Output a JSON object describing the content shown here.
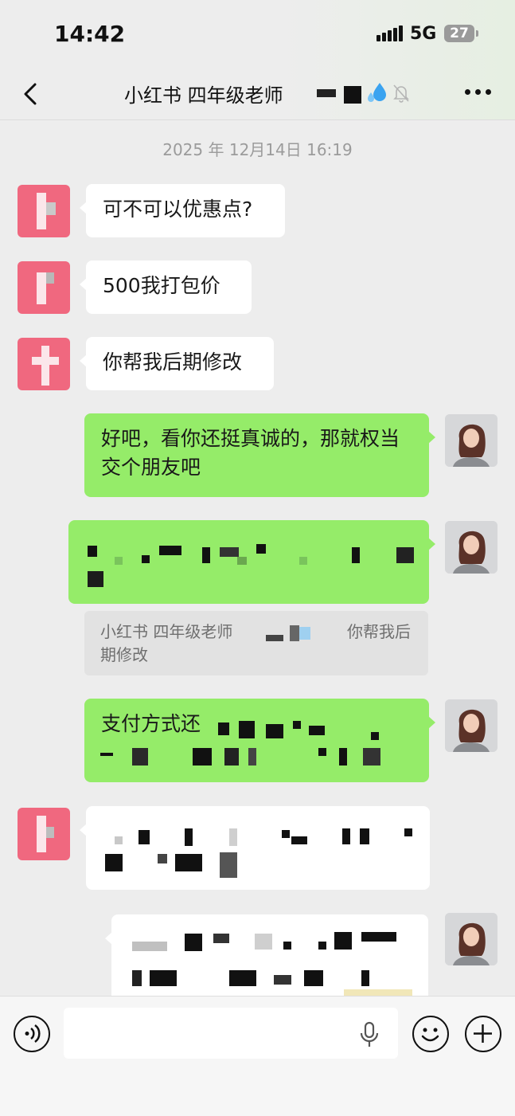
{
  "status_bar": {
    "time": "14:42",
    "network": "5G",
    "battery": "27"
  },
  "header": {
    "title": "小红书 四年级老师"
  },
  "timestamp": "2025 年 12月14日 16:19",
  "messages": [
    {
      "side": "left",
      "text": "可不可以优惠点?"
    },
    {
      "side": "left",
      "text": "500我打包价"
    },
    {
      "side": "left",
      "text": "你帮我后期修改"
    },
    {
      "side": "right",
      "text": "好吧，看你还挺真诚的，那就权当交个朋友吧"
    },
    {
      "side": "right",
      "text": ""
    },
    {
      "side": "right",
      "text": "支付方式还"
    },
    {
      "side": "left",
      "text": ""
    },
    {
      "side": "right",
      "text": ""
    }
  ],
  "quote": {
    "sender": "小红书 四年级老师",
    "text_head": "你帮我后",
    "text_tail": "期修改"
  },
  "input_bar": {
    "placeholder": ""
  },
  "icons": {
    "back": "chevron-left-icon",
    "mute": "bell-off-icon",
    "more": "ellipsis-icon",
    "voice": "voice-mode-icon",
    "mic": "microphone-icon",
    "emoji": "emoji-icon",
    "add": "plus-icon"
  },
  "colors": {
    "sent_bubble": "#95ec69",
    "received_bubble": "#ffffff",
    "background": "#ededed",
    "avatar_pink": "#f0687f"
  }
}
